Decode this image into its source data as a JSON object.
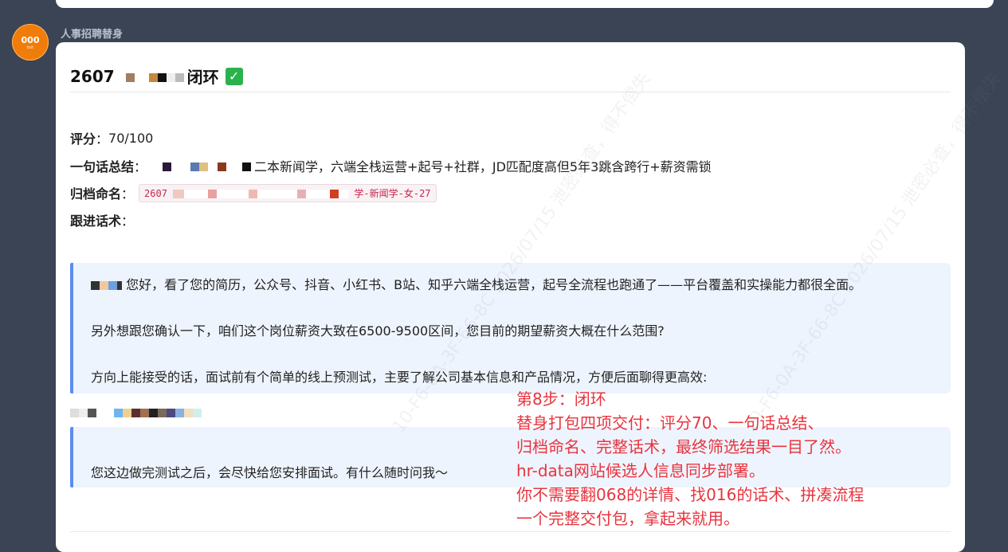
{
  "sender": {
    "name": "人事招聘替身"
  },
  "avatar": {
    "text": "000",
    "subtext": "bot"
  },
  "message": {
    "title": "2607",
    "title_status": "闭环",
    "score_label": "评分",
    "score_value": "70/100",
    "summary_label": "一句话总结",
    "summary_value": "二本新闻学，六端全栈运营+起号+社群，JD匹配度高但5年3跳含跨行+薪资需锁",
    "archive_label": "归档命名",
    "archive_prefix": "2607",
    "archive_suffix": "学-新闻学-女-27",
    "script_label": "跟进话术",
    "quote1": {
      "line1": "您好，看了您的简历，公众号、抖音、小红书、B站、知乎六端全栈运营，起号全流程也跑通了——平台覆盖和实操能力都很全面。",
      "line2": "另外想跟您确认一下，咱们这个岗位薪资大致在6500-9500区间，您目前的期望薪资大概在什么范围?",
      "line3": "方向上能接受的话，面试前有个简单的线上预测试，主要了解公司基本信息和产品情况，方便后面聊得更高效:"
    },
    "quote2": {
      "line1": "您这边做完测试之后，会尽快给您安排面试。有什么随时问我～"
    }
  },
  "overlay": {
    "lines": [
      "第8步：闭环",
      "替身打包四项交付：评分70、一句话总结、",
      "归档命名、完整话术，最终筛选结果一目了然。",
      "hr-data网站候选人信息同步部署。",
      "你不需要翻068的详情、找016的话术、拼凑流程",
      "一个完整交付包，拿起来就用。"
    ]
  },
  "watermark": {
    "text": "10-F6-0A-3F-66-8C 2026/07/15 泄密必查，得不偿失"
  },
  "colors": {
    "background": "#3b4454",
    "quote_border": "#5b8def",
    "overlay_text": "#e8343f",
    "avatar": "#f07c0a"
  }
}
